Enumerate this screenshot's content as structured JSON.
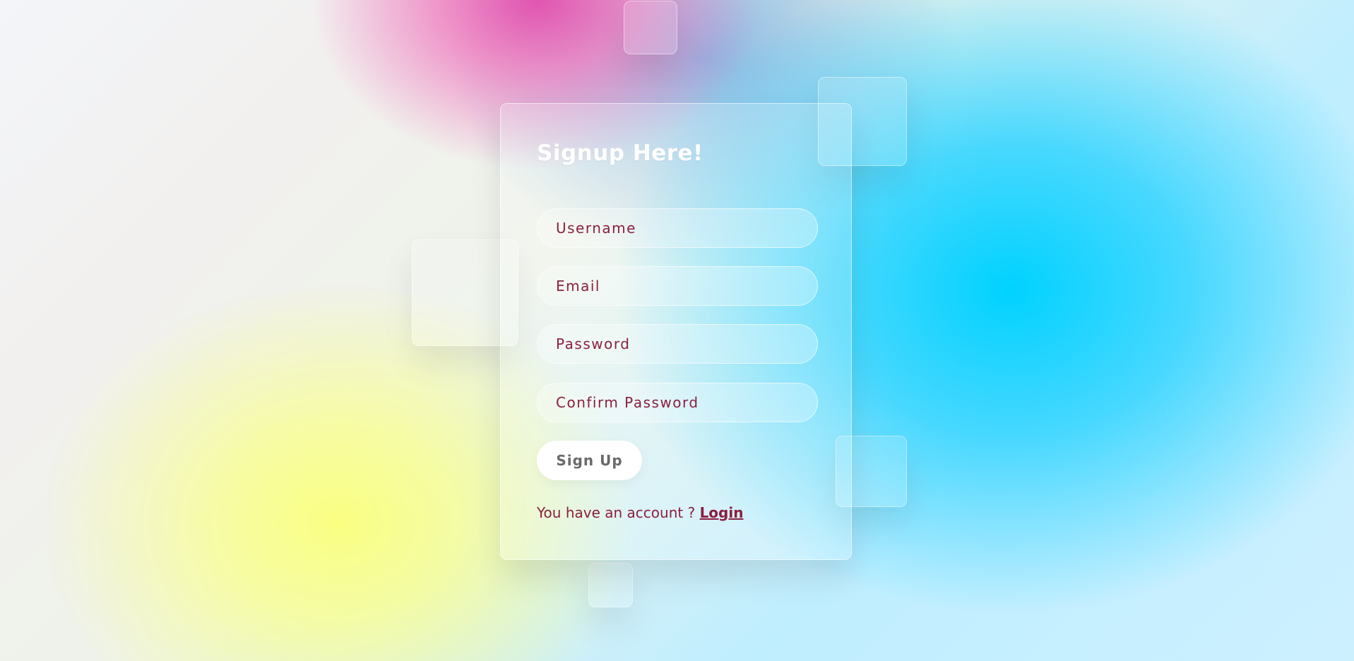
{
  "form": {
    "title": "Signup Here!",
    "username_placeholder": "Username",
    "email_placeholder": "Email",
    "password_placeholder": "Password",
    "confirm_password_placeholder": "Confirm Password",
    "submit_label": "Sign Up",
    "footer_prefix": "You have an account ?",
    "login_link": "Login"
  },
  "colors": {
    "text_accent": "#8a1f3f",
    "button_background": "#ffffff",
    "title_color": "#ffffff"
  }
}
